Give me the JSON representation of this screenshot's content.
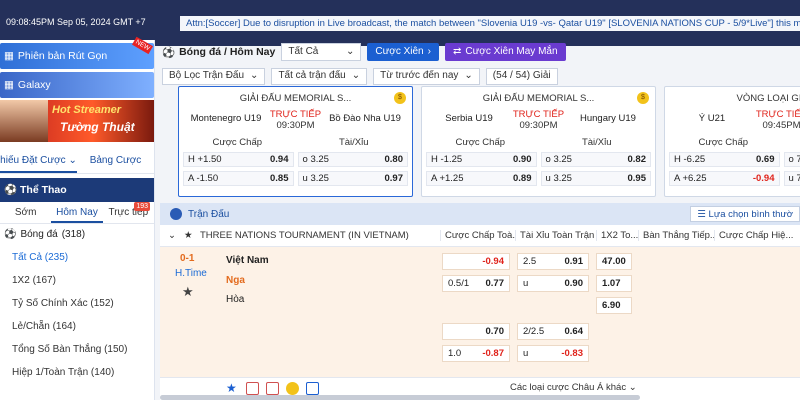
{
  "topbar": {
    "time": "09:08:45PM Sep 05, 2024 GMT +7",
    "notice": "Attn:[Soccer] Due to disruption in Live broadcast, the match between \"Slovenia U19 -vs- Qatar U19\" [SLOVENIA NATIONS CUP - 5/9*Live\"] this match"
  },
  "sidebar": {
    "promo1": "Phiên bản Rút Gọn",
    "promo1_badge": "NEW",
    "promo2": "Galaxy",
    "streamer_line1": "Hot Streamer",
    "streamer_line2": "Tường Thuật",
    "tabs": [
      "hiếu Đặt Cược",
      "Bảng Cược"
    ],
    "sport": "Thể Thao",
    "time_tabs": [
      "Sớm",
      "Hôm Nay",
      "Trực tiếp"
    ],
    "live_badge": "193",
    "ball": "Bóng đá",
    "ball_count": "(318)",
    "markets": [
      "Tất Cả (235)",
      "1X2 (167)",
      "Tỷ Số Chính Xác (152)",
      "Lẻ/Chẵn (164)",
      "Tổng Số Bàn Thắng (150)",
      "Hiệp 1/Toàn Trận (140)"
    ]
  },
  "filters": {
    "title": "Bóng đá / Hôm Nay",
    "all": "Tất Cả",
    "cuoc_xien": "Cược Xiên",
    "cuoc_xien_may_man": "Cược Xiên May Mắn",
    "loc_tran": "Bộ Lọc Trận Đấu",
    "tat_ca_tran": "Tất cả trận đấu",
    "tu_truoc": "Từ trước đến nay",
    "giai_count": "(54 / 54) Giải"
  },
  "cards": [
    {
      "league": "GIẢI ĐẤU MEMORIAL S...",
      "home": "Montenegro U19",
      "away": "Bồ Đào Nha U19",
      "status": "TRỰC TIẾP",
      "time": "09:30PM",
      "h_label": "Cược Chấp",
      "ou_label": "Tài/Xỉu",
      "rows": [
        {
          "hc_side": "H",
          "hc_line": "+1.50",
          "hc_odd": "0.94",
          "ou_side": "o",
          "ou_line": "3.25",
          "ou_odd": "0.80"
        },
        {
          "hc_side": "A",
          "hc_line": "-1.50",
          "hc_odd": "0.85",
          "ou_side": "u",
          "ou_line": "3.25",
          "ou_odd": "0.97"
        }
      ]
    },
    {
      "league": "GIẢI ĐẤU MEMORIAL S...",
      "home": "Serbia U19",
      "away": "Hungary U19",
      "status": "TRỰC TIẾP",
      "time": "09:30PM",
      "h_label": "Cược Chấp",
      "ou_label": "Tài/Xỉu",
      "rows": [
        {
          "hc_side": "H",
          "hc_line": "-1.25",
          "hc_odd": "0.90",
          "ou_side": "o",
          "ou_line": "3.25",
          "ou_odd": "0.82"
        },
        {
          "hc_side": "A",
          "hc_line": "+1.25",
          "hc_odd": "0.89",
          "ou_side": "u",
          "ou_line": "3.25",
          "ou_odd": "0.95"
        }
      ]
    },
    {
      "league": "VÒNG LOẠI GIẢI V...",
      "home": "Ý U21",
      "away": "",
      "status": "TRỰC TIẾP",
      "time": "09:45PM",
      "h_label": "Cược Chấp",
      "ou_label": "",
      "rows": [
        {
          "hc_side": "H",
          "hc_line": "-6.25",
          "hc_odd": "0.69",
          "ou_side": "o",
          "ou_line": "7.",
          "ou_odd": ""
        },
        {
          "hc_side": "A",
          "hc_line": "+6.25",
          "hc_odd": "-0.94",
          "ou_side": "u",
          "ou_line": "7.",
          "ou_odd": ""
        }
      ]
    }
  ],
  "matches": {
    "section": "Trận Đấu",
    "choose": "Lựa chọn bình thườ",
    "tournament": "THREE NATIONS TOURNAMENT (IN VIETNAM)",
    "cols": [
      "Cược Chấp Toà...",
      "Tài Xỉu Toàn Trận",
      "1X2 To...",
      "Bàn Thắng Tiếp...",
      "Cược Chấp Hiệ..."
    ],
    "score": "0-1",
    "period": "H.Time",
    "home": "Việt Nam",
    "away": "Nga",
    "draw": "Hòa",
    "r1_hc": "-0.94",
    "r1_ou_line": "2.5",
    "r1_ou_odd": "0.91",
    "r1_1x2": "47.00",
    "r2_hc_line": "0.5/1",
    "r2_hc_odd": "0.77",
    "r2_ou_side": "u",
    "r2_ou_odd": "0.90",
    "r2_1x2": "1.07",
    "r3_1x2": "6.90",
    "r4_hc": "0.70",
    "r4_ou_line": "2/2.5",
    "r4_ou_odd": "0.64",
    "r5_hc_line": "1.0",
    "r5_hc_odd": "-0.87",
    "r5_ou_side": "u",
    "r5_ou_odd": "-0.83",
    "more": "Các loại cược Châu Á khác"
  }
}
